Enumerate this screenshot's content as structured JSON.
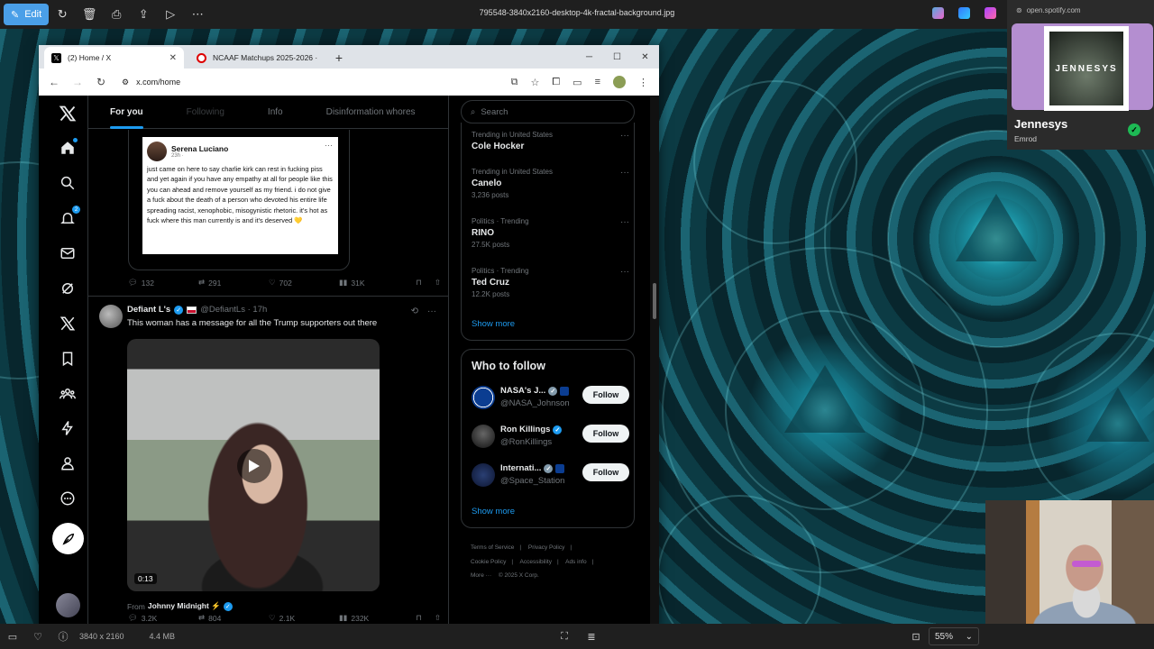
{
  "viewer": {
    "edit_label": "Edit",
    "filename": "795548-3840x2160-desktop-4k-fractal-background.jpg",
    "dimensions": "3840 x 2160",
    "filesize": "4.4 MB",
    "zoom": "55%"
  },
  "browser": {
    "tabs": [
      {
        "title": "(2) Home / X",
        "active": true
      },
      {
        "title": "NCAAF Matchups 2025-2026 ·",
        "active": false
      }
    ],
    "url": "x.com/home"
  },
  "x": {
    "timeline_tabs": [
      "For you",
      "Following",
      "Info",
      "Disinformation whores"
    ],
    "nav_badge": "2",
    "quote": {
      "name": "Serena Luciano",
      "time": "23h ·",
      "text": "just came on here to say charlie kirk can rest in fucking piss and yet again if you have any empathy at all for people like this you can ahead and remove yourself as my friend. i do not give a fuck about the death of a person who devoted his entire life spreading racist, xenophobic, misogynistic rhetoric. it's hot as fuck where this man currently is and it's deserved 💛"
    },
    "post1_actions": {
      "replies": "132",
      "reposts": "291",
      "likes": "702",
      "views": "31K"
    },
    "post2": {
      "name": "Defiant L's",
      "handle": "@DefiantLs · 17h",
      "text": "This woman has a message for all the Trump supporters out there",
      "video_time": "0:13",
      "from_label": "From",
      "from_name": "Johnny Midnight ⚡",
      "actions": {
        "replies": "3.2K",
        "reposts": "804",
        "likes": "2.1K",
        "views": "232K"
      }
    },
    "search_placeholder": "Search",
    "trends": [
      {
        "meta": "Trending in United States",
        "name": "Cole Hocker",
        "count": ""
      },
      {
        "meta": "Trending in United States",
        "name": "Canelo",
        "count": "3,236 posts"
      },
      {
        "meta": "Politics · Trending",
        "name": "RINO",
        "count": "27.5K posts"
      },
      {
        "meta": "Politics · Trending",
        "name": "Ted Cruz",
        "count": "12.2K posts"
      }
    ],
    "show_more": "Show more",
    "who_to_follow": {
      "title": "Who to follow",
      "accounts": [
        {
          "name": "NASA's J...",
          "handle": "@NASA_Johnson"
        },
        {
          "name": "Ron Killings",
          "handle": "@RonKillings"
        },
        {
          "name": "Internati...",
          "handle": "@Space_Station"
        }
      ],
      "follow_label": "Follow",
      "show_more": "Show more"
    },
    "footer": [
      "Terms of Service",
      "|",
      "Privacy Policy",
      "|",
      "Cookie Policy",
      "|",
      "Accessibility",
      "|",
      "Ads info",
      "|",
      "More ···",
      "© 2025 X Corp."
    ]
  },
  "spotify": {
    "url": "open.spotify.com",
    "album_text": "JENNESYS",
    "title": "Jennesys",
    "artist": "Emrod"
  }
}
